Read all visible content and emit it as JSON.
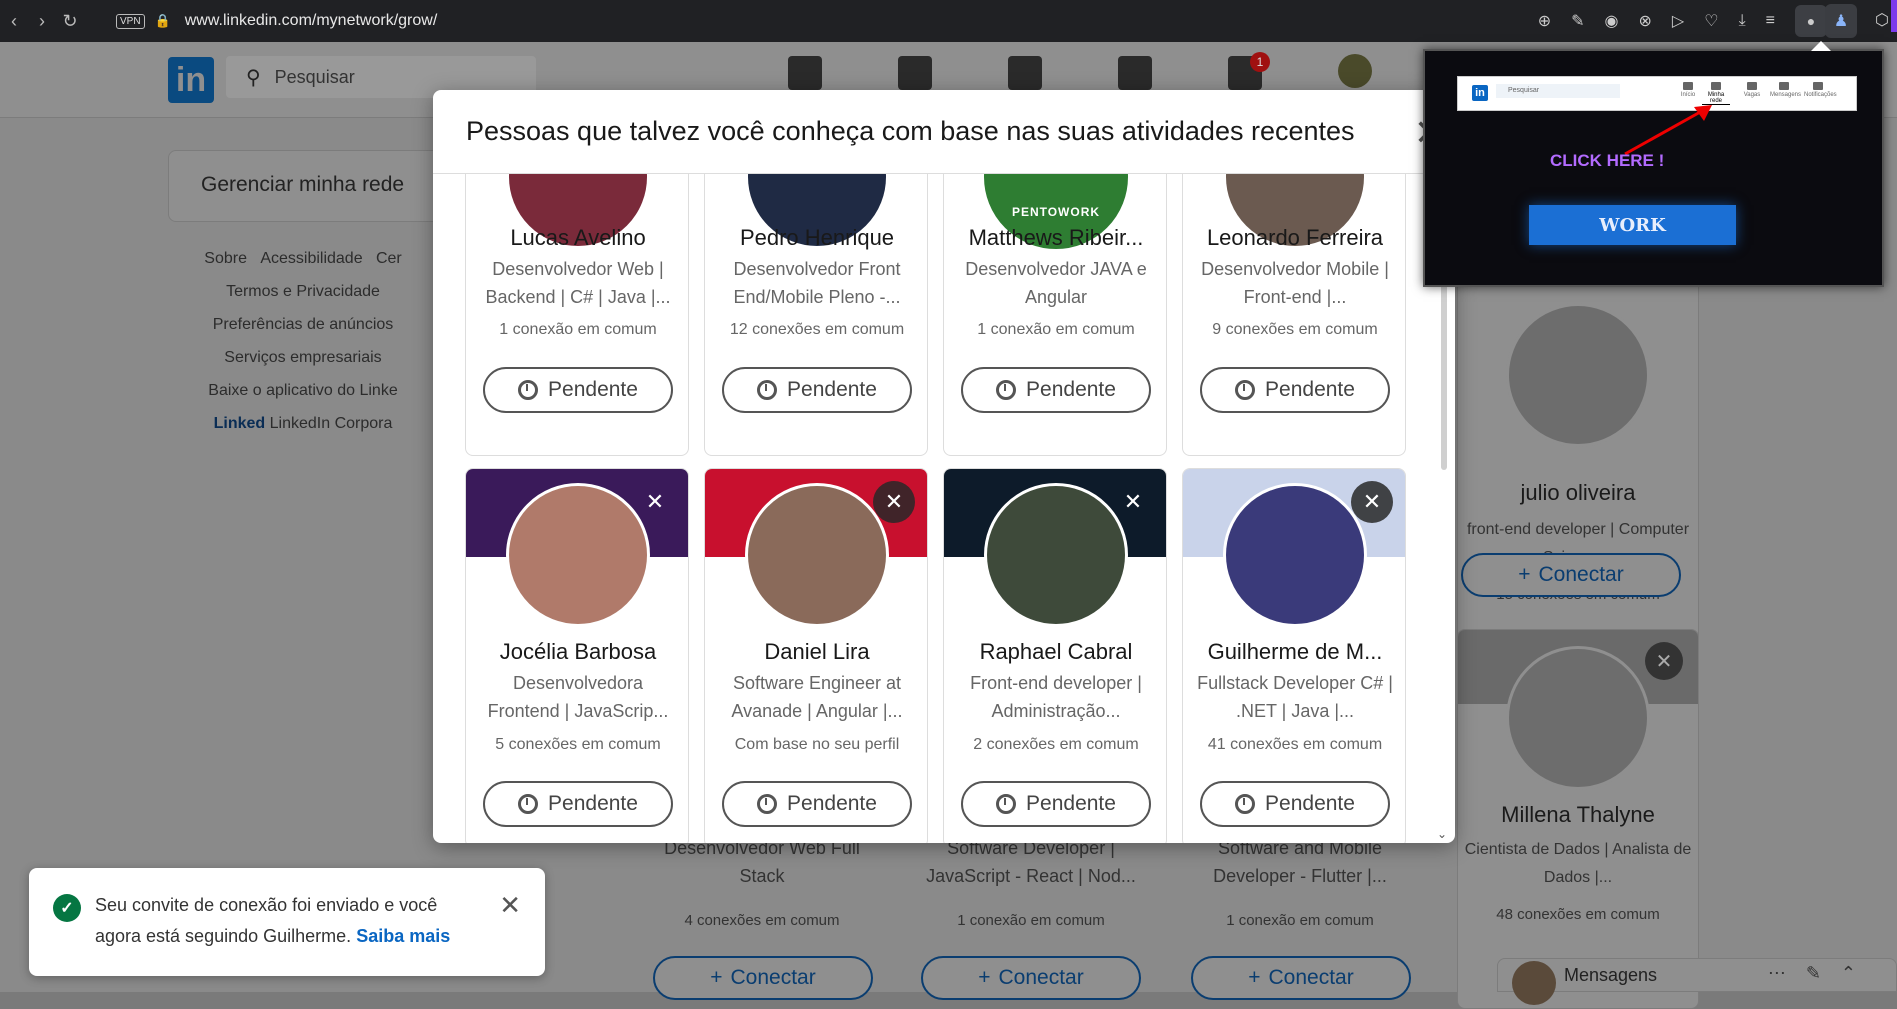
{
  "browser": {
    "vpn_label": "VPN",
    "url": "www.linkedin.com/mynetwork/grow/"
  },
  "linkedin": {
    "logo": "in",
    "search_placeholder": "Pesquisar",
    "notifications_count": "1",
    "manage_network": "Gerenciar minha rede",
    "footer_links": [
      "Sobre",
      "Acessibilidade",
      "Cer",
      "Termos e Privacidade",
      "Preferências de anúncios",
      "Serviços empresariais",
      "Baixe o aplicativo do Linke"
    ],
    "footer_brand": "Linked",
    "footer_corp": "LinkedIn Corpora"
  },
  "modal": {
    "title": "Pessoas que talvez você conheça com base nas suas atividades recentes",
    "close_icon": "close-icon",
    "pending_label": "Pendente",
    "cards": [
      {
        "name": "Lucas Avelino",
        "headline": "Desenvolvedor Web | Backend | C# | Java |...",
        "mutual": "1 conexão em comum"
      },
      {
        "name": "Pedro Henrique",
        "headline": "Desenvolvedor Front End/Mobile Pleno -...",
        "mutual": "12 conexões em comum"
      },
      {
        "name": "Matthews Ribeir...",
        "headline": "Desenvolvedor JAVA e Angular",
        "mutual": "1 conexão em comum",
        "badge_text": "PENTOWORK"
      },
      {
        "name": "Leonardo Ferreira",
        "headline": "Desenvolvedor Mobile | Front-end |...",
        "mutual": "9 conexões em comum"
      },
      {
        "name": "Jocélia Barbosa",
        "headline": "Desenvolvedora Frontend | JavaScrip...",
        "mutual": "5 conexões em comum"
      },
      {
        "name": "Daniel Lira",
        "headline": "Software Engineer at Avanade | Angular |...",
        "mutual": "Com base no seu perfil"
      },
      {
        "name": "Raphael Cabral",
        "headline": "Front-end developer | Administração...",
        "mutual": "2 conexões em comum"
      },
      {
        "name": "Guilherme de M...",
        "headline": "Fullstack Developer C# | .NET | Java |...",
        "mutual": "41 conexões em comum"
      }
    ]
  },
  "background": {
    "connect_label": "Conectar",
    "right_cards": [
      {
        "name": "julio oliveira",
        "headline": "front-end developer | Computer Science...",
        "mutual": "15 conexões em comum"
      },
      {
        "name": "Millena Thalyne",
        "headline": "Cientista de Dados | Analista de Dados |...",
        "mutual": "48 conexões em comum"
      }
    ],
    "bottom_cards": [
      {
        "headline": "Desenvolvedor Web Full Stack",
        "mutual": "4 conexões em comum"
      },
      {
        "headline": "Software Developer | JavaScript - React | Nod...",
        "mutual": "1 conexão em comum"
      },
      {
        "headline": "Software and Mobile Developer - Flutter |...",
        "mutual": "1 conexão em comum"
      }
    ],
    "messaging_label": "Mensagens"
  },
  "toast": {
    "message": "Seu convite de conexão foi enviado e você agora está seguindo Guilherme.",
    "link": "Saiba mais"
  },
  "extension_popup": {
    "mini_search": "Pesquisar",
    "mini_nav": [
      "Início",
      "Minha rede",
      "Vagas",
      "Mensagens",
      "Notificações"
    ],
    "click_here": "CLICK HERE !",
    "work_button": "WORK"
  }
}
